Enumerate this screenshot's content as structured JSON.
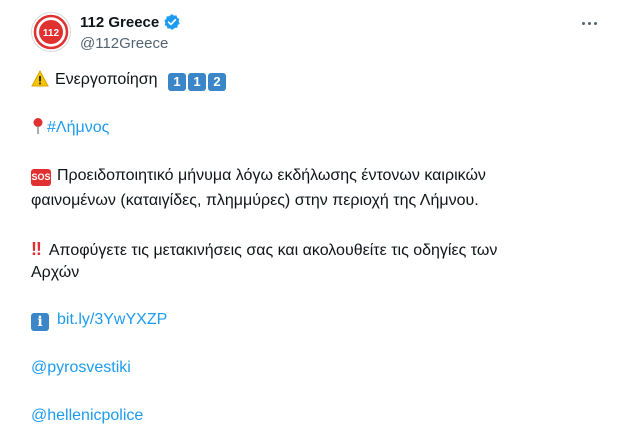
{
  "author": {
    "display_name": "112 Greece",
    "handle": "@112Greece",
    "avatar_text": "112",
    "verified_icon": "verified-badge-icon"
  },
  "more_icon": "more-options-icon",
  "body": {
    "line1": {
      "icon": "warning-icon",
      "text": "Ενεργοποίηση",
      "keycaps": [
        "1",
        "1",
        "2"
      ]
    },
    "line2": {
      "icon": "round-pushpin-icon",
      "hashtag": "#Λήμνος"
    },
    "line3": {
      "icon": "sos-icon",
      "icon_text": "SOS",
      "text_a": "Προειδοποιητικό μήνυμα λόγω εκδήλωσης έντονων καιρικών",
      "text_b": "φαινομένων (καταιγίδες, πλημμύρες) στην περιοχή της Λήμνου."
    },
    "line4": {
      "icon": "double-exclamation-icon",
      "icon_text": "‼",
      "text_a": "Αποφύγετε τις μετακινήσεις σας και ακολουθείτε τις οδηγίες των",
      "text_b": "Αρχών"
    },
    "line5": {
      "icon": "information-icon",
      "icon_text": "i",
      "link": "bit.ly/3YwYXZP"
    },
    "mention1": "@pyrosvestiki",
    "mention2": "@hellenicpolice"
  },
  "colors": {
    "link": "#1d9bf0",
    "brand_red": "#e03030",
    "keycap_blue": "#3a86c8",
    "verified": "#1d9bf0"
  }
}
